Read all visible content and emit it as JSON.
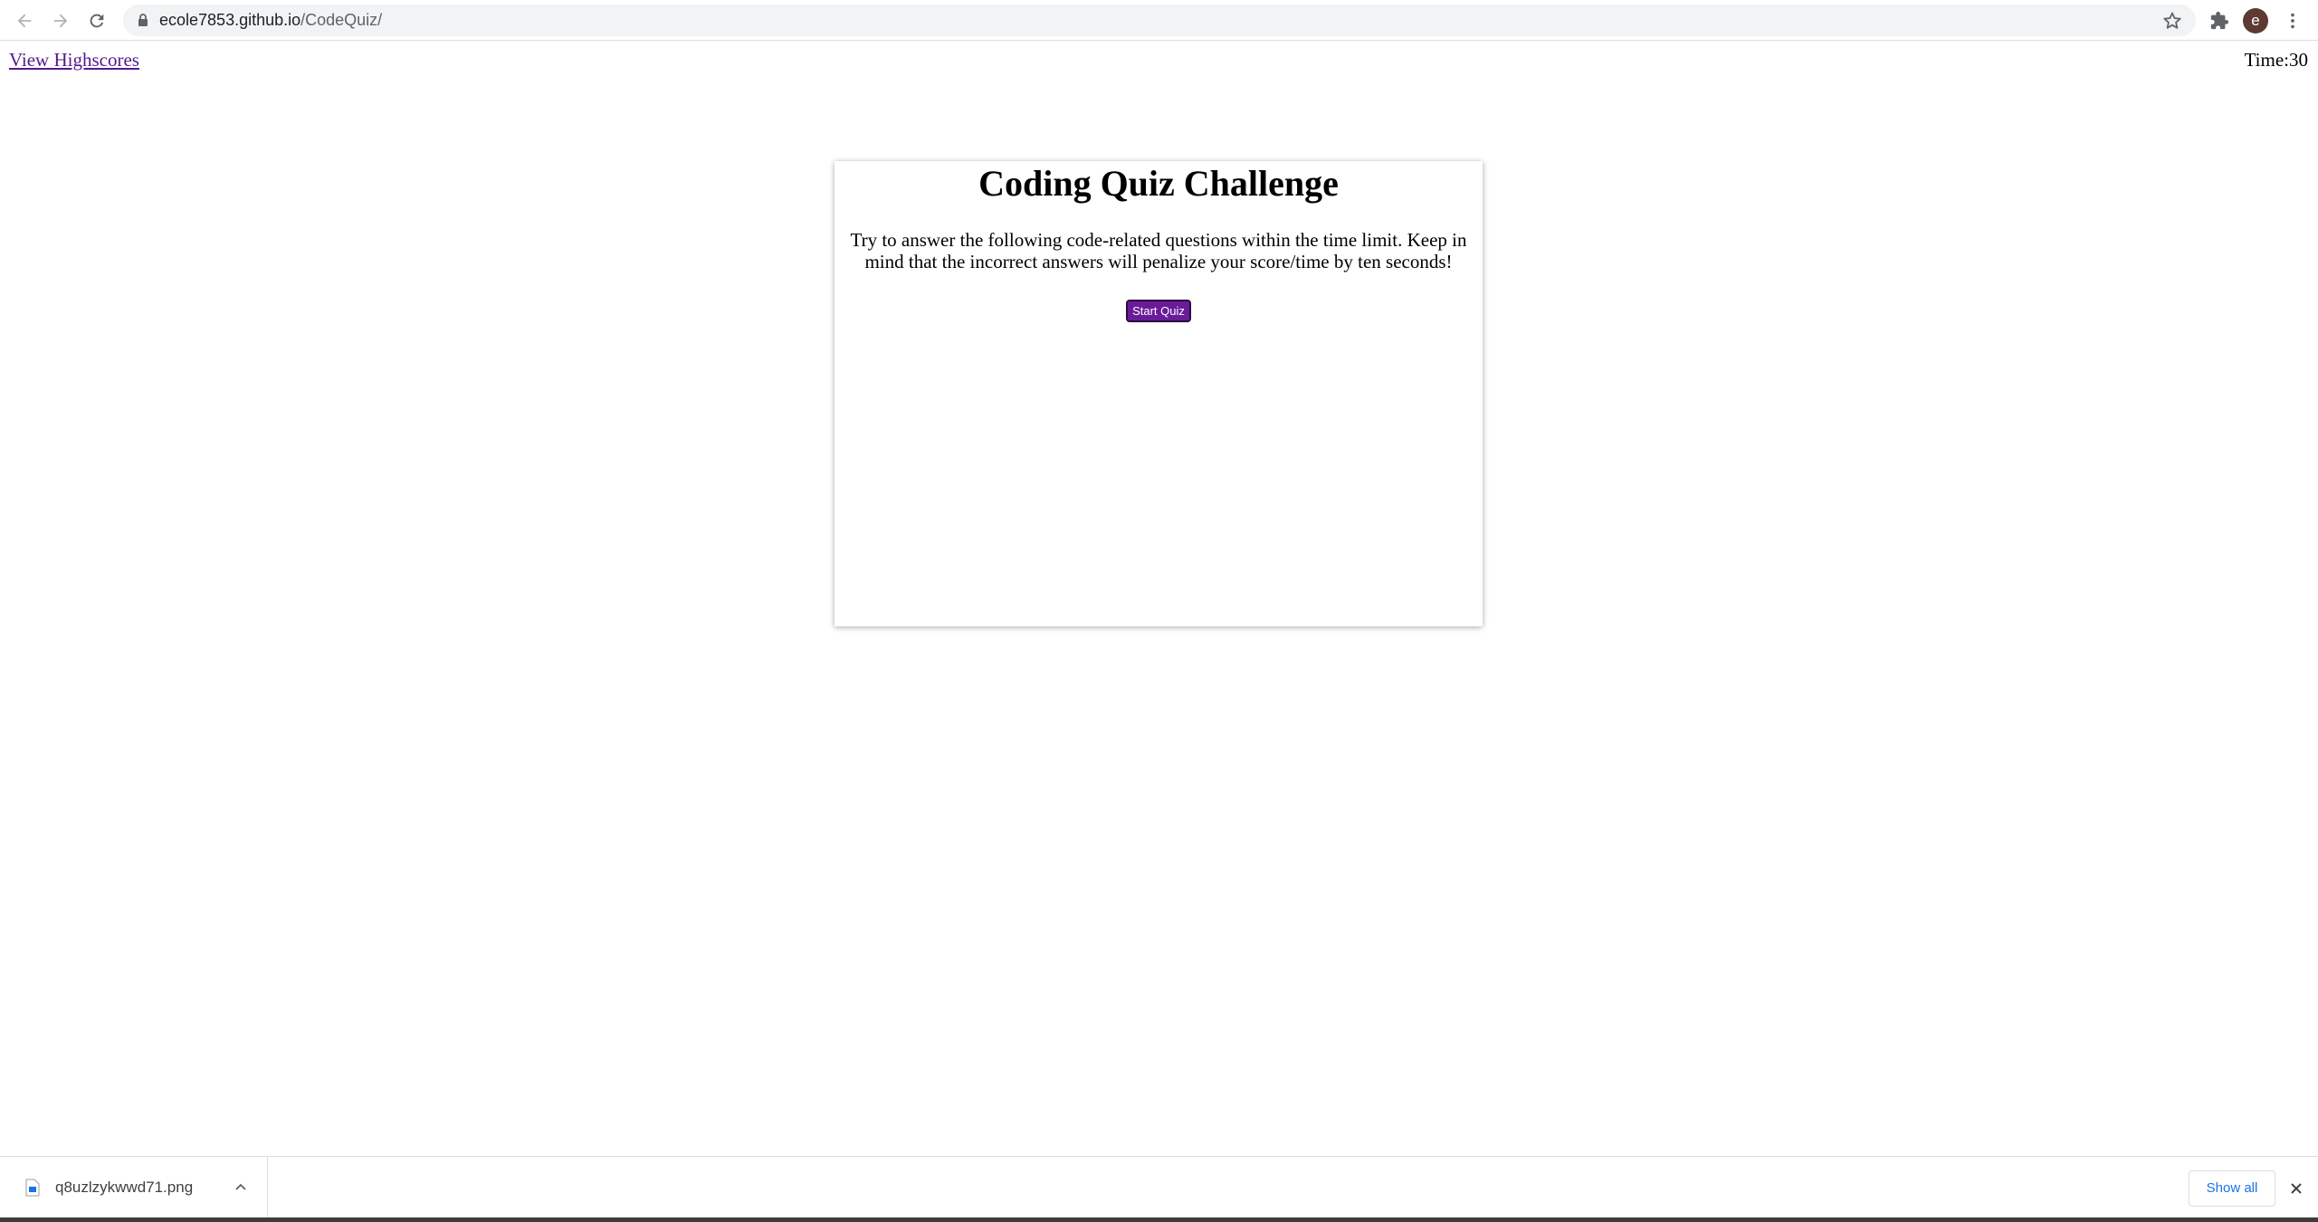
{
  "browser": {
    "url_domain": "ecole7853.github.io",
    "url_path": "/CodeQuiz/",
    "profile_initial": "e"
  },
  "page": {
    "highscores_link": "View Highscores",
    "timer_label": "Time:",
    "timer_value": "30",
    "title": "Coding Quiz Challenge",
    "description": "Try to answer the following code-related questions within the time limit. Keep in mind that the incorrect answers will penalize your score/time by ten seconds!",
    "start_button": "Start Quiz",
    "accent_color": "#6a1b9a"
  },
  "downloads": {
    "file_name": "q8uzlzykwwd71.png",
    "show_all_label": "Show all"
  }
}
